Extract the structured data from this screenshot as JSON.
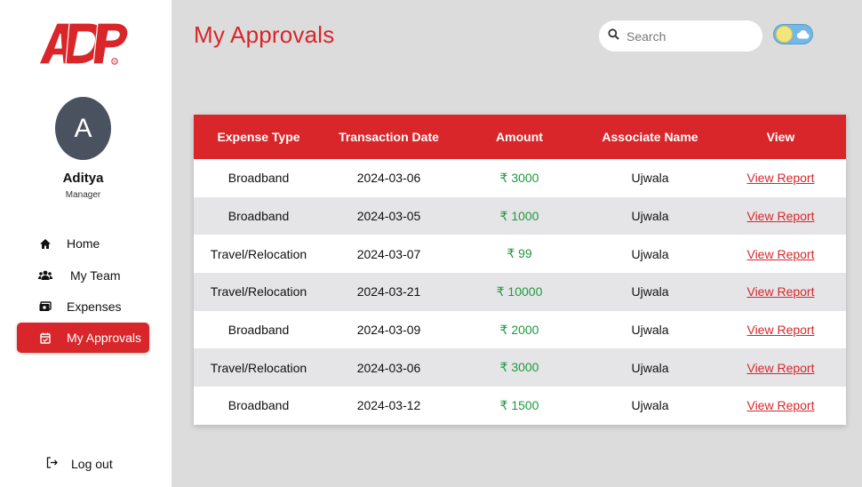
{
  "brand": {
    "logo_text": "ADP",
    "registered_mark": "®",
    "color": "#d8262a"
  },
  "user": {
    "avatar_initial": "A",
    "name": "Aditya",
    "role": "Manager"
  },
  "nav": {
    "items": [
      {
        "label": "Home",
        "icon": "home-icon"
      },
      {
        "label": "My Team",
        "icon": "team-icon"
      },
      {
        "label": "Expenses",
        "icon": "expenses-icon"
      },
      {
        "label": "My Approvals",
        "icon": "approvals-icon",
        "active": true
      }
    ],
    "logout_label": "Log out"
  },
  "header": {
    "title": "My Approvals",
    "search_placeholder": "Search",
    "theme_toggle": "light"
  },
  "table": {
    "columns": [
      "Expense Type",
      "Transaction Date",
      "Amount",
      "Associate Name",
      "View"
    ],
    "rows": [
      {
        "type": "Broadband",
        "date": "2024-03-06",
        "amount": "₹ 3000",
        "associate": "Ujwala",
        "view": "View Report"
      },
      {
        "type": "Broadband",
        "date": "2024-03-05",
        "amount": "₹ 1000",
        "associate": "Ujwala",
        "view": "View Report"
      },
      {
        "type": "Travel/Relocation",
        "date": "2024-03-07",
        "amount": "₹ 99",
        "associate": "Ujwala",
        "view": "View Report"
      },
      {
        "type": "Travel/Relocation",
        "date": "2024-03-21",
        "amount": "₹ 10000",
        "associate": "Ujwala",
        "view": "View Report"
      },
      {
        "type": "Broadband",
        "date": "2024-03-09",
        "amount": "₹ 2000",
        "associate": "Ujwala",
        "view": "View Report"
      },
      {
        "type": "Travel/Relocation",
        "date": "2024-03-06",
        "amount": "₹ 3000",
        "associate": "Ujwala",
        "view": "View Report"
      },
      {
        "type": "Broadband",
        "date": "2024-03-12",
        "amount": "₹ 1500",
        "associate": "Ujwala",
        "view": "View Report"
      }
    ]
  },
  "colors": {
    "accent": "#d8262a",
    "amount_green": "#1e9a3e",
    "background": "#dcdcdd"
  }
}
